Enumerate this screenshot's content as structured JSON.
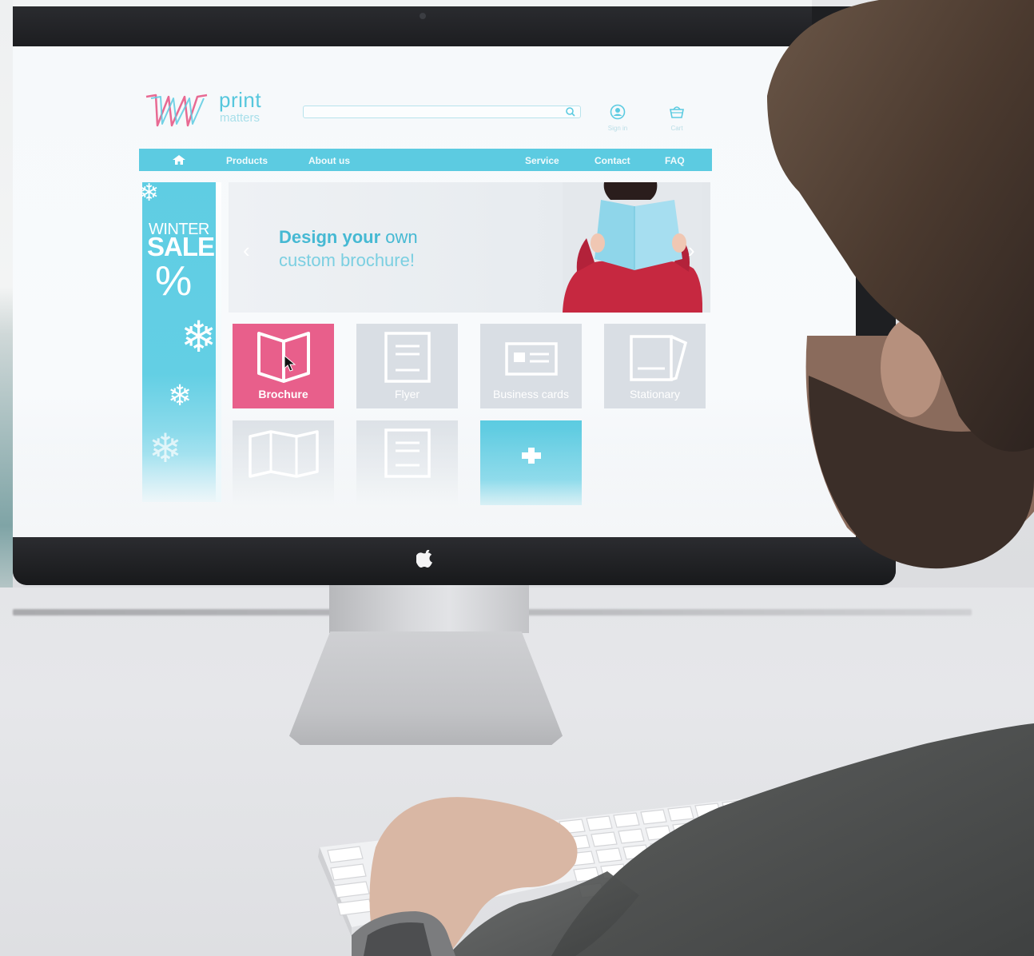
{
  "site": {
    "logo_title": "print",
    "logo_subtitle": "matters",
    "search_placeholder": "",
    "tools": {
      "signin_label": "Sign in",
      "cart_label": "Cart"
    },
    "nav": {
      "products": "Products",
      "about": "About us",
      "service": "Service",
      "contact": "Contact",
      "faq": "FAQ"
    },
    "sale": {
      "line1": "WINTER",
      "line2": "SALE",
      "symbol": "%"
    },
    "hero": {
      "line1_bold": "Design your",
      "line1_rest": " own",
      "line2": "custom brochure!",
      "prev": "‹",
      "next": "›"
    },
    "tiles": [
      {
        "label": "Brochure",
        "icon": "brochure-icon",
        "state": "hovered"
      },
      {
        "label": "Flyer",
        "icon": "flyer-icon",
        "state": "normal"
      },
      {
        "label": "Business cards",
        "icon": "business-card-icon",
        "state": "normal"
      },
      {
        "label": "Stationary",
        "icon": "stationary-icon",
        "state": "normal"
      },
      {
        "label": "",
        "icon": "folded-map-icon",
        "state": "normal"
      },
      {
        "label": "",
        "icon": "document-icon",
        "state": "normal"
      },
      {
        "label": "",
        "icon": "add-icon",
        "state": "normal"
      }
    ]
  },
  "colors": {
    "accent_blue": "#5ccbe1",
    "accent_pink": "#e85f8b",
    "tile_grey": "#d9dee4",
    "screen_bg": "#f7f9fb"
  },
  "scene": {
    "device": "desktop monitor with apple logo",
    "apple_logo": "apple-logo"
  }
}
